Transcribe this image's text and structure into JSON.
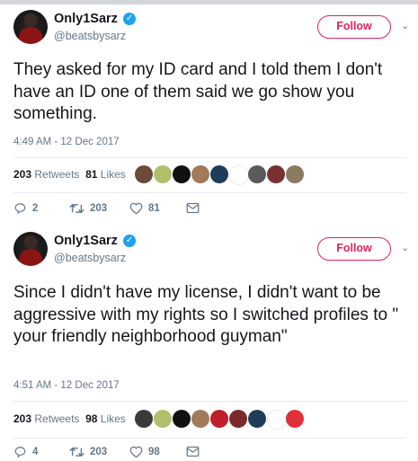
{
  "tweets": [
    {
      "name": "Only1Sarz",
      "handle": "@beatsbysarz",
      "follow_label": "Follow",
      "text": "They asked for my ID card and I told them I don't have an ID one of them said we go show you something.",
      "time": "4:49 AM - 12 Dec 2017",
      "retweets": "203",
      "retweets_label": "Retweets",
      "likes": "81",
      "likes_label": "Likes",
      "actions": {
        "reply": "2",
        "retweet": "203",
        "like": "81"
      },
      "liker_colors": [
        "#6b4a3a",
        "#b0c06a",
        "#111111",
        "#a07a5a",
        "#1e3d5a",
        "#ffffff",
        "#5a5a5a",
        "#7a3030",
        "#8a7a60"
      ]
    },
    {
      "name": "Only1Sarz",
      "handle": "@beatsbysarz",
      "follow_label": "Follow",
      "text": "Since I didn't have my license, I didn't want to be aggressive with my rights so I switched profiles to \" your friendly neighborhood guyman\"",
      "time": "4:51 AM - 12 Dec 2017",
      "retweets": "203",
      "retweets_label": "Retweets",
      "likes": "98",
      "likes_label": "Likes",
      "actions": {
        "reply": "4",
        "retweet": "203",
        "like": "98"
      },
      "liker_colors": [
        "#3a3a3a",
        "#b0c06a",
        "#111111",
        "#a07a5a",
        "#c0202a",
        "#7a2a2a",
        "#1e3d5a",
        "#ffffff",
        "#e0303a"
      ]
    }
  ],
  "brand_colors": {
    "verified": "#1da1f2",
    "follow": "#e0245e",
    "muted": "#657786"
  }
}
